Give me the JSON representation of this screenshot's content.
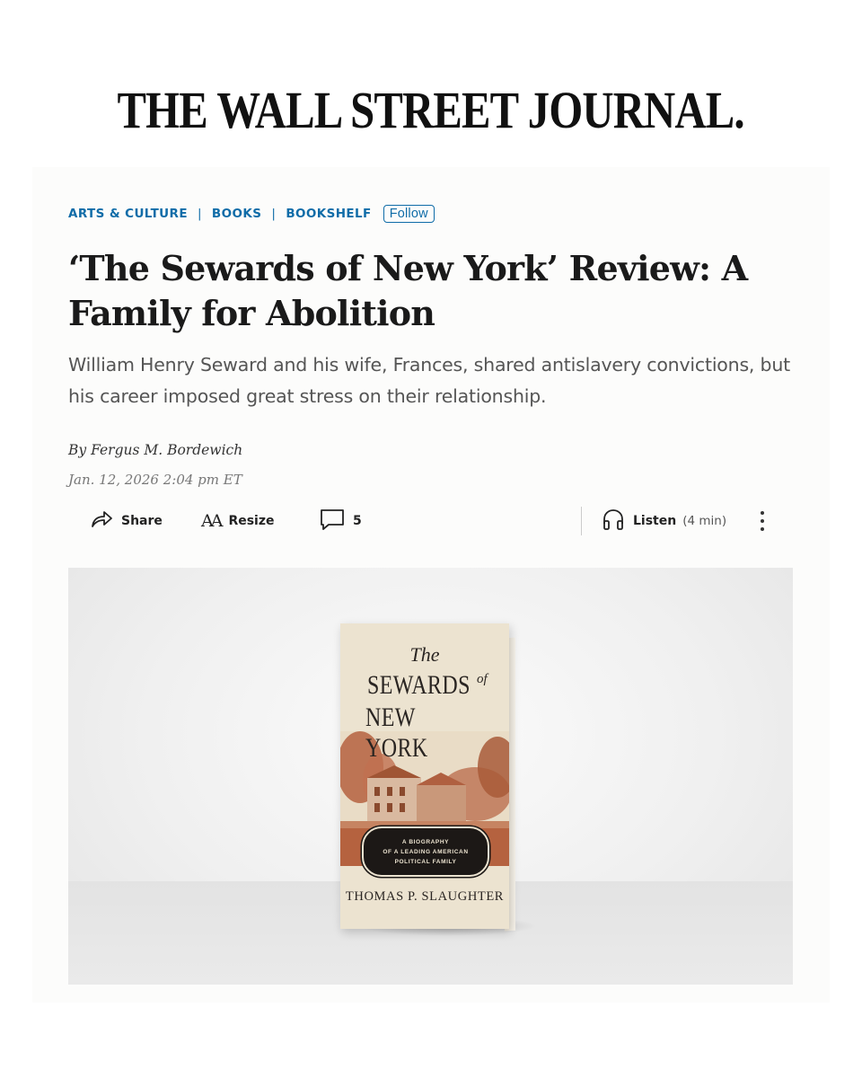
{
  "masthead": {
    "title": "THE WALL STREET JOURNAL."
  },
  "breadcrumbs": {
    "items": [
      "ARTS & CULTURE",
      "BOOKS",
      "BOOKSHELF"
    ],
    "separator": "|",
    "follow_label": "Follow"
  },
  "article": {
    "headline": "‘The Sewards of New York’ Review: A Family for Abolition",
    "dek": "William Henry Seward and his wife, Frances, shared antislavery convictions, but his career imposed great stress on their relationship.",
    "byline": "By Fergus M. Bordewich",
    "date": "Jan. 12, 2026 2:04 pm ET"
  },
  "toolbar": {
    "share_label": "Share",
    "resize_icon_text": "AA",
    "resize_label": "Resize",
    "comments_count": "5",
    "listen_label": "Listen",
    "listen_duration": "(4 min)"
  },
  "hero": {
    "book": {
      "the": "The",
      "title_line1": "SEWARDS",
      "of": "of",
      "title_line2": "NEW YORK",
      "subtitle_lines": [
        "A BIOGRAPHY",
        "OF A LEADING AMERICAN",
        "POLITICAL FAMILY"
      ],
      "author": "THOMAS P. SLAUGHTER"
    }
  },
  "colors": {
    "link_blue": "#0f6ca8",
    "headline": "#1a1a1a",
    "dek": "#555555",
    "book_cover": "#ece3d0",
    "book_illustration": "#b5623f"
  }
}
